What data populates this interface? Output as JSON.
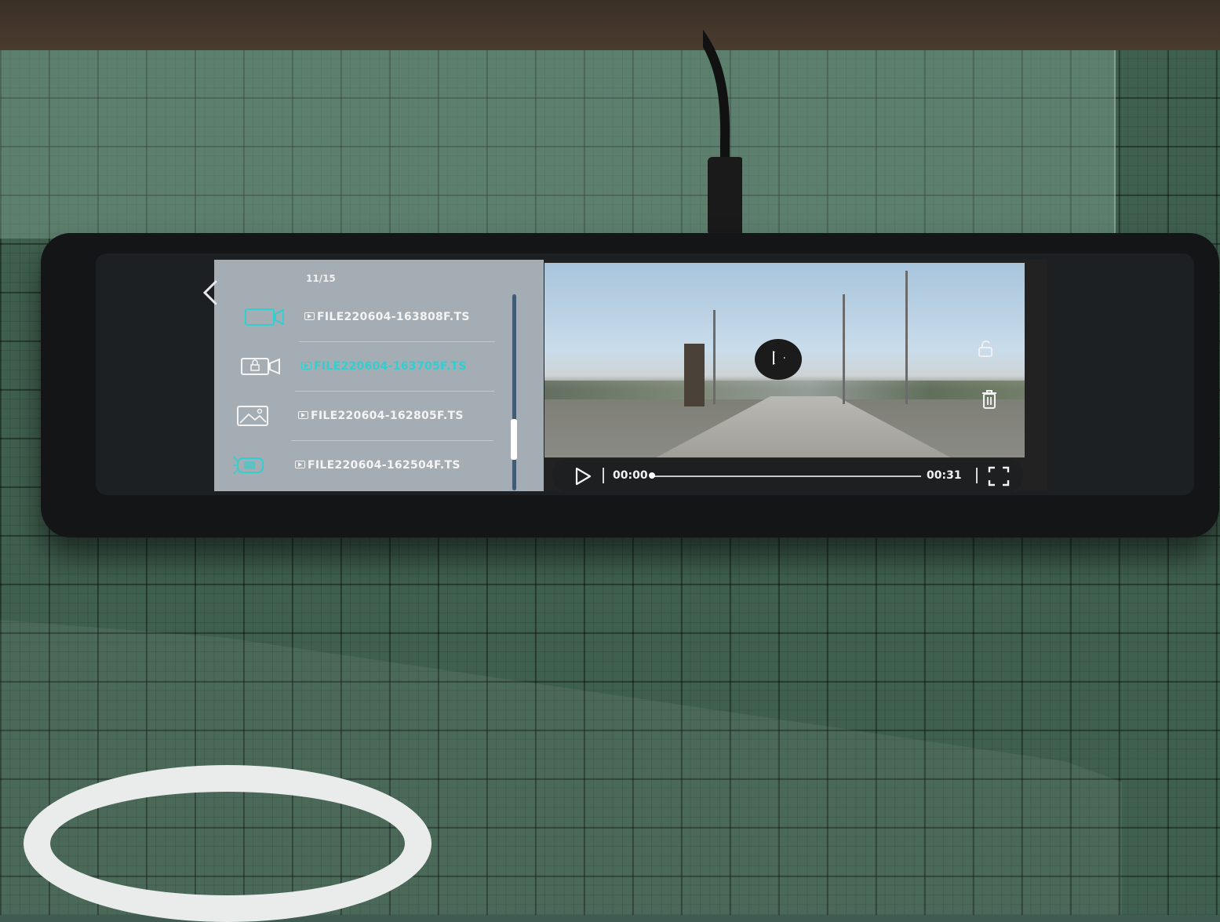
{
  "file_list": {
    "counter": "11/15",
    "items": [
      {
        "name": "FILE220604-163808F.TS",
        "icon": "video-camera-icon",
        "active": false
      },
      {
        "name": "FILE220604-163705F.TS",
        "icon": "locked-video-icon",
        "active": true
      },
      {
        "name": "FILE220604-162805F.TS",
        "icon": "image-icon",
        "active": false
      },
      {
        "name": "FILE220604-162504F.TS",
        "icon": "parking-car-icon",
        "active": false
      }
    ]
  },
  "player": {
    "current_time": "00:00",
    "duration": "00:31",
    "progress": 0
  },
  "colors": {
    "accent": "#2fd0cf",
    "list_bg": "#a4acb4",
    "control_bar": "#1d1f21"
  }
}
